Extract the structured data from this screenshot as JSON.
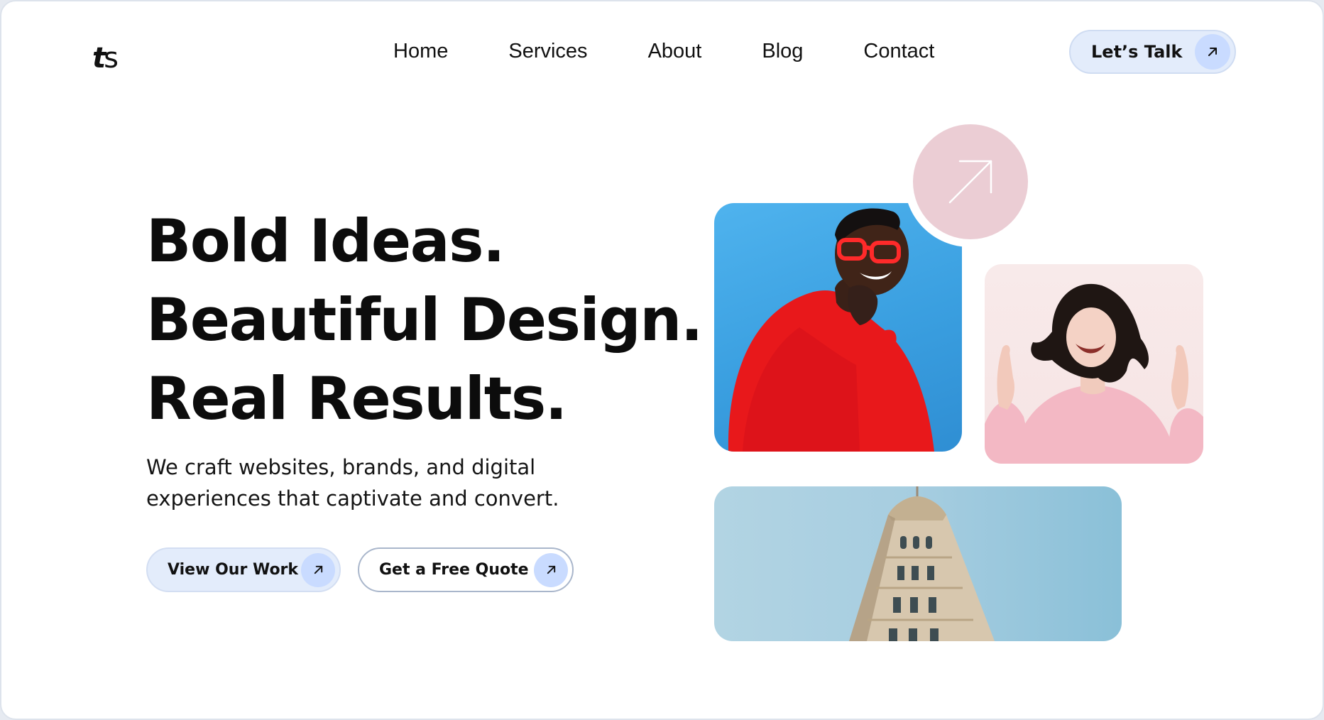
{
  "header": {
    "logo": {
      "letter_t": "t",
      "letter_s": "s"
    },
    "nav": [
      "Home",
      "Services",
      "About",
      "Blog",
      "Contact"
    ],
    "cta": {
      "label": "Let’s Talk",
      "icon": "arrow-up-right-icon"
    }
  },
  "hero": {
    "title_lines": [
      "Bold Ideas.",
      "Beautiful Design.",
      "Real Results."
    ],
    "subtitle_line1": "We craft websites, brands, and digital",
    "subtitle_line2": "experiences that captivate and convert.",
    "buttons": {
      "primary": {
        "label": "View Our Work",
        "icon": "arrow-up-right-icon"
      },
      "secondary": {
        "label": "Get a Free Quote",
        "icon": "arrow-up-right-icon"
      }
    }
  },
  "collage": {
    "images": [
      {
        "subject": "man-in-red-sweater-photo"
      },
      {
        "subject": "laughing-woman-photo"
      },
      {
        "subject": "building-facade-photo"
      }
    ],
    "accent_icon": "arrow-up-right-icon"
  },
  "colors": {
    "accent_light_blue": "#e3ecfb",
    "accent_blue_circle": "#c9dbff",
    "accent_pink": "#ebcdd4",
    "text": "#111111"
  }
}
